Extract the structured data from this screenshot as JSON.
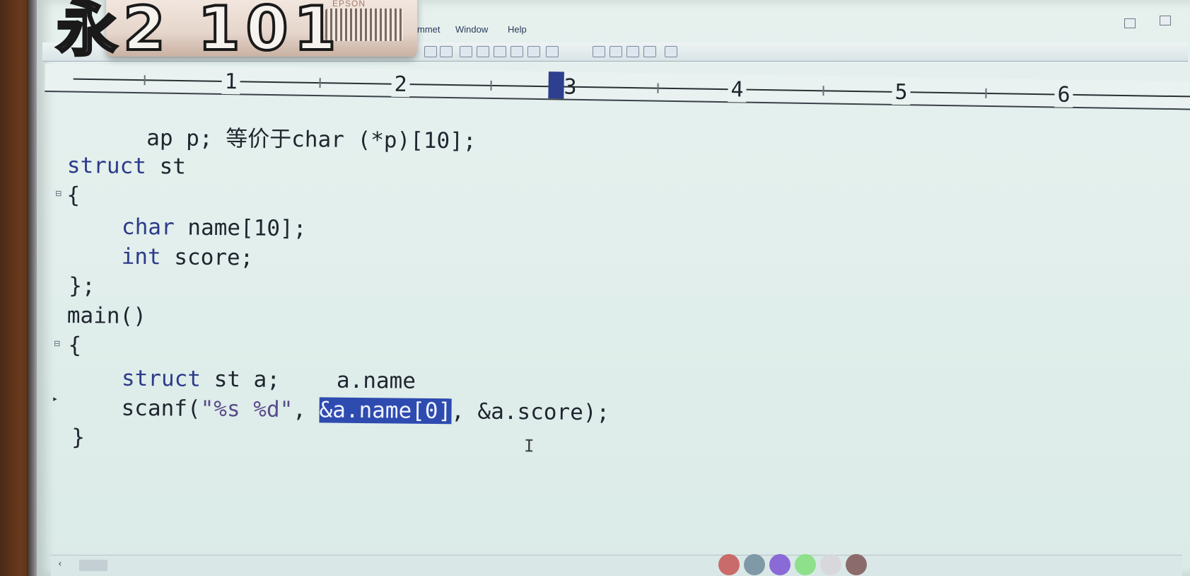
{
  "title_overlay": "永2 101",
  "projector": {
    "brand": "EPSON"
  },
  "menu": {
    "items": [
      "mmet",
      "Window",
      "Help"
    ]
  },
  "ruler": {
    "numbers": [
      "1",
      "2",
      "3",
      "4",
      "5",
      "6"
    ]
  },
  "code": {
    "line1": "ap p; 等价于char (*p)[10];",
    "line2_kw": "struct",
    "line2_rest": " st",
    "line3": "{",
    "line4_kw": "char",
    "line4_rest": " name[10];",
    "line5_kw": "int",
    "line5_rest": " score;",
    "line6": "};",
    "line7": "main()",
    "line8": "{",
    "line9_kw": "struct",
    "line9_rest": " st a;",
    "line9_note": "a.name",
    "line10_pre": "scanf(",
    "line10_str": "\"%s %d\"",
    "line10_comma": ", ",
    "line10_sel": "&a.name[0]",
    "line10_post": ", &a.score);",
    "line11": "}"
  },
  "status": {
    "dot_colors": [
      "#c96b6b",
      "#7f9aa6",
      "#8a6ad6",
      "#8fe08a",
      "#d8d8dc",
      "#8b6b6b"
    ]
  }
}
